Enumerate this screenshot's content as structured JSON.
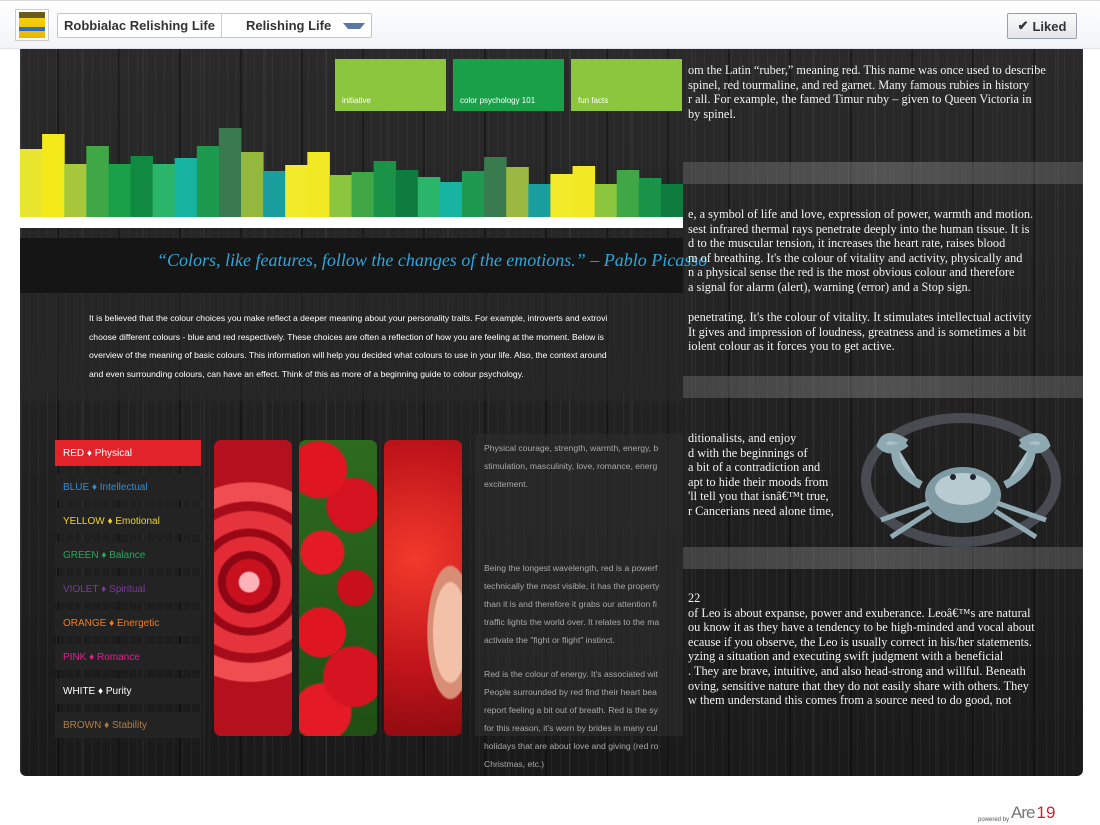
{
  "page": {
    "breadcrumb_page": "Robbialac Relishing Life",
    "breadcrumb_tab": "Relishing Life",
    "liked_label": "Liked"
  },
  "header_tabs": [
    "initiative",
    "color psychology 101",
    "fun facts"
  ],
  "bar_colors": [
    "#e7e52d",
    "#f4ea19",
    "#a6c83a",
    "#3fa746",
    "#1aa049",
    "#0f8a40",
    "#2bb56a",
    "#17b4a2",
    "#1e9a4f",
    "#3b7a4f",
    "#94b73e",
    "#1b9e9e",
    "#f3ea2a",
    "#f2e823",
    "#8cc63e",
    "#3fa746",
    "#1a9348",
    "#0e7b3f",
    "#2bb56a",
    "#17b4a2",
    "#1d9a50",
    "#3a7a4f",
    "#9bb842",
    "#1b9e9e",
    "#f3ea2a",
    "#f2e823",
    "#8cc63e",
    "#3fa746",
    "#1a9348",
    "#0e7b3f"
  ],
  "quote": "“Colors, like features, follow the changes of the emotions.” – Pablo Picasso",
  "intro_lines": [
    "It is believed that the colour choices you make reflect a deeper meaning about your personality traits. For example, introverts and extrovi",
    "choose different colours - blue and red respectively. These choices are often a reflection of how you are feeling at the moment. Below is",
    "overview of the meaning of basic colours. This information will help you decided what colours to use in your life. Also, the context around",
    "and even surrounding colours, can have an effect. Think of this as more of a beginning guide to colour psychology."
  ],
  "color_list": [
    {
      "label": "RED ♦ Physical",
      "color": "#ffffff"
    },
    {
      "label": "BLUE ♦ Intellectual",
      "color": "#2f8fd6"
    },
    {
      "label": "YELLOW ♦ Emotional",
      "color": "#f0d423"
    },
    {
      "label": "GREEN ♦ Balance",
      "color": "#27a85a"
    },
    {
      "label": "VIOLET ♦ Spiritual",
      "color": "#7a3c9c"
    },
    {
      "label": "ORANGE ♦ Energetic",
      "color": "#ef7d25"
    },
    {
      "label": "PINK ♦ Romance",
      "color": "#e0208d"
    },
    {
      "label": "WHITE ♦ Purity",
      "color": "#ffffff"
    },
    {
      "label": "BROWN ♦ Stability",
      "color": "#b07c47"
    }
  ],
  "red_description": [
    "Physical courage, strength, warmth, energy, b",
    "stimulation, masculinity, love, romance, energ",
    "excitement.",
    "Being the longest wavelength, red is a powerf",
    "technically the most visible, it has the property",
    "than it is and therefore it grabs our attention fi",
    "traffic lights the world over. It relates to the ma",
    "activate the \"fight or flight\" instinct.",
    "Red is the colour of energy. It's associated wit",
    "People surrounded by red find their heart bea",
    "report feeling a bit out of breath. Red is the sy",
    "for this reason, it's worn by brides in many cul",
    "holidays that are about love and giving (red ro",
    "Christmas, etc.)"
  ],
  "right_panel": {
    "block1": [
      "om the Latin “ruber,” meaning red. This name was once used to describe",
      "spinel, red tourmaline, and red garnet. Many famous rubies in history",
      "r all. For example, the famed Timur ruby – given to Queen Victoria in",
      "by spinel."
    ],
    "block2": [
      "e, a symbol of life and love, expression of power, warmth and motion.",
      "sest infrared thermal rays penetrate deeply into the human tissue. It is",
      "d to the muscular tension, it increases the heart rate, raises blood",
      "m of breathing. It's the colour of vitality and activity, physically and",
      "n a physical sense the red is the most obvious colour and therefore",
      " a signal for alarm (alert), warning (error) and a Stop sign."
    ],
    "block3": [
      "penetrating. It's the colour of vitality. It stimulates intellectual activity",
      "It gives and impression of loudness, greatness and is sometimes a bit",
      "iolent colour as it forces you to get active."
    ],
    "block4": [
      "ditionalists, and enjoy",
      "d with the beginnings of",
      " a bit of a contradiction and",
      "apt to hide their moods from",
      "'ll tell you that isnâ€™t true,",
      "r Cancerians need alone time,"
    ],
    "block5": [
      "22",
      "of Leo is about expanse, power and exuberance. Leoâ€™s are natural",
      "ou know it as they have a tendency to be high-minded and vocal about",
      "ecause if you observe, the Leo is usually correct in his/her statements.",
      "yzing a situation and executing swift judgment with a beneficial",
      ". They are brave, intuitive, and also head-strong and willful. Beneath",
      "oving, sensitive nature that they do not easily share with others. They",
      "w them understand this comes from a source need to do good, not"
    ]
  },
  "footer": {
    "powered_by": "powered by",
    "brand": "Are",
    "brand_num": "19"
  }
}
